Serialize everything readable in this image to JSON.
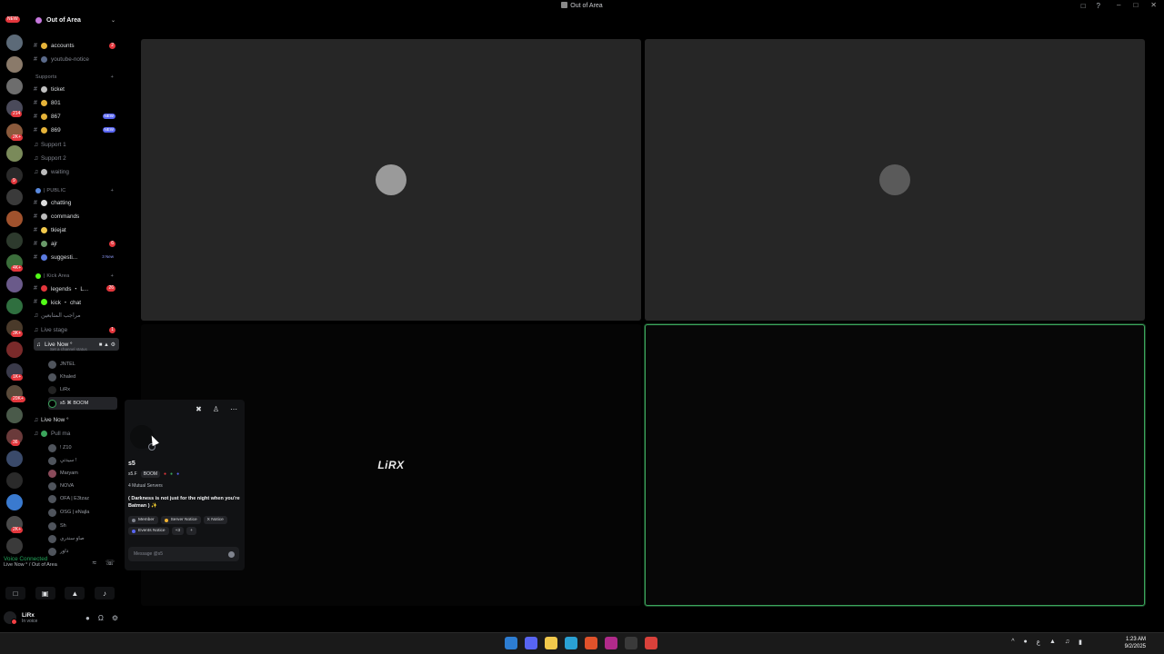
{
  "window": {
    "title": "Out of Area"
  },
  "rail": {
    "new_badge": "NEW",
    "badges": [
      "52",
      "214",
      "2K+",
      "9",
      "4K+",
      "3K+",
      "1K+",
      "20K+",
      "36",
      "2K+",
      "1K+"
    ]
  },
  "server": {
    "name": "Out of Area"
  },
  "channels": [
    {
      "name": "accounts",
      "count": "2"
    },
    {
      "name": "youtube-notice"
    }
  ],
  "supports": {
    "category": "Supports",
    "channels": [
      {
        "name": "ticket"
      },
      {
        "name": "801"
      },
      {
        "name": "867",
        "tag": "NEW"
      },
      {
        "name": "869",
        "tag": "NEW"
      },
      {
        "name": "Support 1"
      },
      {
        "name": "Support 2"
      },
      {
        "name": "waiting"
      }
    ]
  },
  "public": {
    "category": "| PUBLIC",
    "channels": [
      {
        "name": "chatting"
      },
      {
        "name": "commands"
      },
      {
        "name": "tkiejat"
      },
      {
        "name": "ajr",
        "count": "6"
      },
      {
        "name": "suggesti...",
        "tag": "3 New"
      }
    ]
  },
  "kick": {
    "category": "| Kick Area",
    "channels": [
      {
        "name": "legends ・ L...",
        "count": "26"
      },
      {
        "name": "kick ・ chat"
      },
      {
        "name": "مراجب المتابعين"
      },
      {
        "name": "Live stage",
        "count": "1"
      }
    ]
  },
  "live_now": {
    "label": "Live Now °",
    "status_hint": "Set a channel status",
    "users": [
      "JNTEL",
      "Khaled",
      "LiRx",
      "s5 ⌘ BOOM"
    ]
  },
  "live_now2": {
    "label": "Live Now °",
    "sub_channel": "Pull ma",
    "users": [
      "! Z10",
      "سيدتي !",
      "Maryam",
      "NOVA",
      "OFA | E3tzaz",
      "OSG | eNajla",
      "Sh",
      "صاو سندري",
      "داور"
    ]
  },
  "voice_panel": {
    "status": "Voice Connected",
    "location": "Live Now ° / Out of Area"
  },
  "user": {
    "name": "LiRx",
    "status": "In voice"
  },
  "stage": {
    "tile3_label": "LiRX"
  },
  "profile_popout": {
    "username": "s5",
    "tag": "s5.F",
    "guild_tag": "BOOM",
    "mutual": "4 Mutual Servers",
    "bio": "( Darkness is not just for the night when you're Batman ) ✨",
    "roles": [
      "Member",
      "Server Notice",
      "X Notice",
      "Events Notice",
      "+3"
    ],
    "message_placeholder": "Message @s5"
  },
  "taskbar": {
    "time": "1:23 AM",
    "date": "9/2/2025",
    "lang": "ع"
  },
  "colors": {
    "accent": "#5865f2",
    "speaking": "#3ba55c",
    "badge": "#e3363c",
    "voice_connected": "#23a55a"
  }
}
